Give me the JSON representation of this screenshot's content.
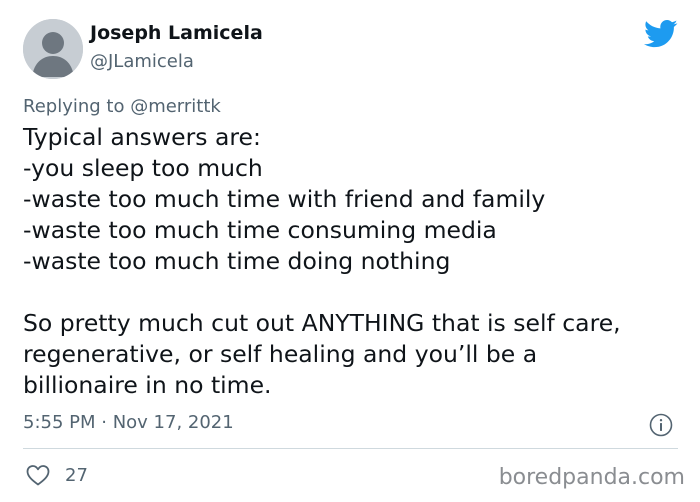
{
  "tweet": {
    "display_name": "Joseph Lamicela",
    "handle": "@JLamicela",
    "reply_prefix": "Replying to ",
    "reply_to": "@merrittk",
    "lines": [
      "Typical answers are:",
      "-you sleep too much",
      "-waste too much time with friend and family",
      "-waste too much time consuming media",
      "-waste too much time doing nothing",
      "",
      "So pretty much cut out ANYTHING that is self care,",
      "regenerative, or self healing and you’ll be a",
      "billionaire in no time."
    ],
    "timestamp": "5:55 PM · Nov 17, 2021",
    "likes": "27"
  },
  "watermark": "boredpanda.com",
  "icons": {
    "avatar": "default-avatar-icon",
    "logo": "twitter-bird-icon",
    "info": "info-icon",
    "like": "heart-icon"
  },
  "colors": {
    "twitter_blue": "#1d9bf0",
    "text_primary": "#0f1419",
    "text_secondary": "#536471",
    "divider": "#cfd9de",
    "watermark": "#8a8d91"
  }
}
